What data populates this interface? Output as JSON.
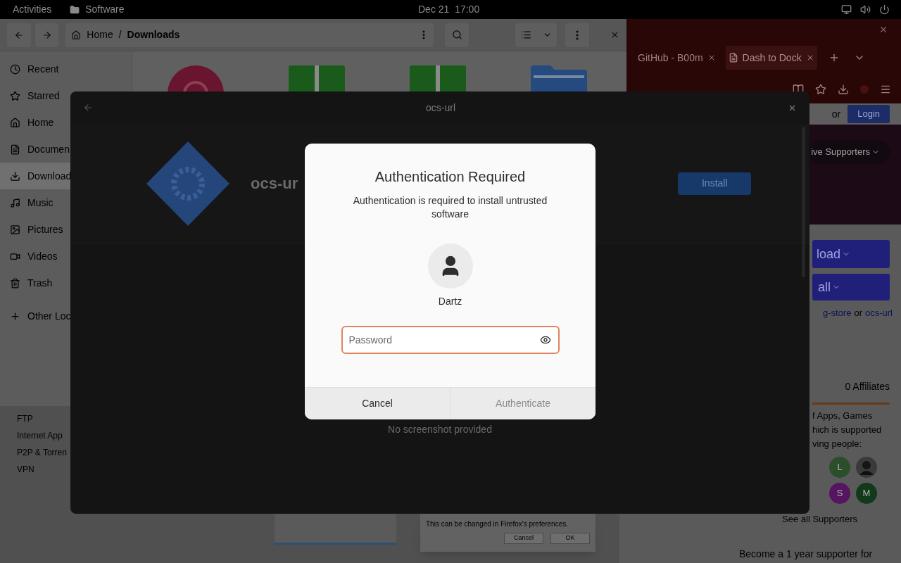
{
  "top_bar": {
    "activities": "Activities",
    "app": "Software",
    "clock": "Dec 21  17:00"
  },
  "files_window": {
    "breadcrumb": [
      "Home",
      "Downloads"
    ],
    "separator": "/",
    "sidebar": [
      {
        "label": "Recent",
        "selected": false
      },
      {
        "label": "Starred",
        "selected": false
      },
      {
        "label": "Home",
        "selected": false
      },
      {
        "label": "Documen",
        "selected": false
      },
      {
        "label": "Download",
        "selected": true
      },
      {
        "label": "Music",
        "selected": false
      },
      {
        "label": "Pictures",
        "selected": false
      },
      {
        "label": "Videos",
        "selected": false
      },
      {
        "label": "Trash",
        "selected": false
      },
      {
        "label": "Other Loc",
        "selected": false
      }
    ]
  },
  "categories": [
    "FTP",
    "Internet App",
    "P2P & Torren",
    "VPN"
  ],
  "browser": {
    "tabs": [
      {
        "label": "GitHub - B00m",
        "selected": false
      },
      {
        "label": "Dash to Dock",
        "selected": true
      }
    ],
    "or_text": "or",
    "login": "Login",
    "supporters_menu": "ive Supporters",
    "download_button": "load",
    "install_button": "all",
    "store_line": [
      {
        "kind": "link",
        "text": "g-store"
      },
      {
        "kind": "plain",
        "text": "or"
      },
      {
        "kind": "link",
        "text": "ocs-url"
      }
    ],
    "affiliates": "0 Affiliates",
    "support_lines": [
      "f Apps, Games",
      "hich is supported",
      "ving people:"
    ],
    "avatars": [
      {
        "kind": "letter",
        "letter": "L",
        "color": "#2a4f2a"
      },
      {
        "kind": "picture"
      },
      {
        "kind": "letter",
        "letter": "S",
        "color": "#551560"
      },
      {
        "kind": "letter",
        "letter": "M",
        "color": "#123a1a"
      }
    ],
    "see_all": "See all Supporters",
    "become": "Become a 1 year supporter for"
  },
  "firefox_prompt": {
    "message": "This can be changed in Firefox's preferences.",
    "buttons": [
      "Cancel",
      "OK"
    ]
  },
  "software_dialog": {
    "title": "ocs-url",
    "app_name": "ocs-ur",
    "install": "Install",
    "no_screenshot": "No screenshot provided"
  },
  "auth_dialog": {
    "title": "Authentication Required",
    "message": "Authentication is required to install untrusted software",
    "user": "Dartz",
    "password": {
      "placeholder": "Password"
    },
    "buttons": [
      {
        "label": "Cancel",
        "disabled": false
      },
      {
        "label": "Authenticate",
        "disabled": true
      }
    ]
  }
}
